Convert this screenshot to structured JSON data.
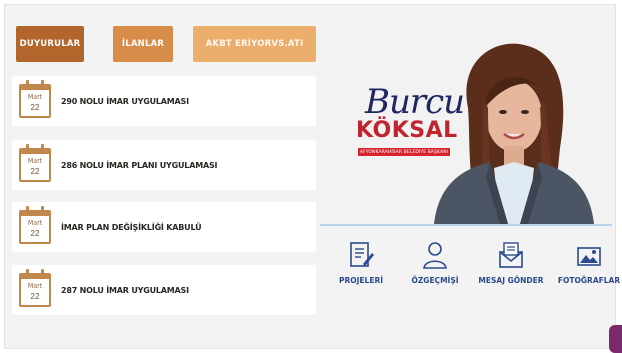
{
  "tabs": [
    {
      "label": "DUYURULAR"
    },
    {
      "label": "İLANLAR"
    },
    {
      "label": "AKBT ERİYORVS.ATI"
    }
  ],
  "announcements": [
    {
      "month": "Mart",
      "day": "22",
      "title": "290 NOLU İMAR UYGULAMASI"
    },
    {
      "month": "Mart",
      "day": "22",
      "title": "286 NOLU İMAR PLANI UYGULAMASI"
    },
    {
      "month": "Mart",
      "day": "22",
      "title": "İMAR PLAN DEĞİŞİKLİĞİ KABULÜ"
    },
    {
      "month": "Mart",
      "day": "22",
      "title": "287 NOLU İMAR UYGULAMASI"
    }
  ],
  "hero": {
    "first_name": "Burcu",
    "last_name": "KÖKSAL",
    "subtitle": "AFYONKARAHİSAR BELEDİYE BAŞKANI"
  },
  "quick_links": [
    {
      "label": "PROJELERİ",
      "icon": "document-edit-icon"
    },
    {
      "label": "ÖZGEÇMİŞİ",
      "icon": "person-icon"
    },
    {
      "label": "MESAJ GÖNDER",
      "icon": "envelope-icon"
    },
    {
      "label": "FOTOĞRAFLAR",
      "icon": "image-icon"
    }
  ],
  "colors": {
    "tab_dark": "#b3662b",
    "tab_mid": "#d88c49",
    "tab_light": "#ecae6c",
    "brand_navy": "#1e2760",
    "brand_red": "#c0242f",
    "link_blue": "#2a4a8c"
  }
}
